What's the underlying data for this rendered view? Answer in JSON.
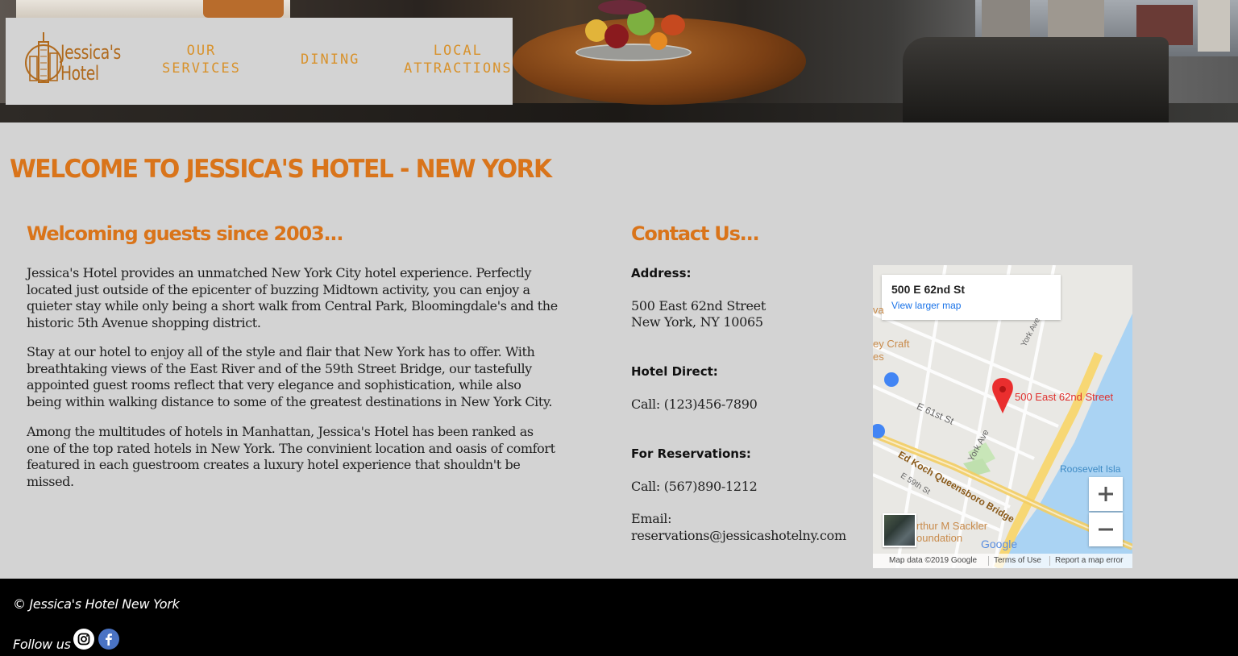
{
  "brand": {
    "logo_text_line1": "Jessica's",
    "logo_text_line2": "Hotel",
    "accent_color": "#d9741a",
    "nav_color": "#d8922c"
  },
  "nav": {
    "items": [
      {
        "line1": "OUR",
        "line2": "SERVICES"
      },
      {
        "line1": "DINING",
        "line2": ""
      },
      {
        "line1": "LOCAL",
        "line2": "ATTRACTIONS"
      }
    ]
  },
  "main": {
    "title": "WELCOME TO JESSICA'S HOTEL - NEW YORK",
    "about": {
      "heading": "Welcoming guests since 2003...",
      "paragraphs": [
        "Jessica's Hotel provides an unmatched New York City hotel experience. Perfectly located just outside of the epicenter of buzzing Midtown activity, you can enjoy a quieter stay while only being a short walk from Central Park, Bloomingdale's and the historic 5th Avenue shopping district.",
        "Stay at our hotel to enjoy all of the style and flair that New York has to offer. With breathtaking views of the East River and of the 59th Street Bridge, our tastefully appointed guest rooms reflect that very elegance and sophistication, while also being within walking distance to some of the greatest destinations in New York City.",
        "Among the multitudes of hotels in Manhattan, Jessica's Hotel has been ranked as one of the top rated hotels in New York. The convinient location and oasis of comfort featured in each guestroom creates a luxury hotel experience that shouldn't be missed."
      ]
    },
    "contact": {
      "heading": "Contact Us...",
      "address_label": "Address:",
      "address_line1": "500 East 62nd Street",
      "address_line2": "New York, NY 10065",
      "direct_label": "Hotel Direct:",
      "direct_phone": "Call: (123)456-7890",
      "reservations_label": "For Reservations:",
      "reservations_phone": "Call: (567)890-1212",
      "email_label": "Email:",
      "email": "reservations@jessicashotelny.com"
    }
  },
  "map": {
    "card_title": "500 E 62nd St",
    "view_larger": "View larger map",
    "pin_label": "500 East 62nd Street",
    "labels": {
      "craft_1": "ey Craft",
      "craft_2": "es",
      "va": "va",
      "e61": "E 61st St",
      "york_ave_1": "York Ave",
      "york_ave_2": "York Ave",
      "bridge": "Ed Koch Queensboro Bridge",
      "e59": "E 59th St",
      "roosevelt": "Roosevelt Isla",
      "sackler_1": "rthur M Sackler",
      "sackler_2": "oundation",
      "google": "Google"
    },
    "zoom_in_icon": "plus-icon",
    "zoom_out_icon": "minus-icon",
    "footer": {
      "data": "Map data ©2019 Google",
      "terms": "Terms of Use",
      "report": "Report a map error"
    },
    "colors": {
      "water": "#aad3f3",
      "road_major": "#f7d774",
      "park": "#c8e6b8"
    }
  },
  "footer": {
    "copyright": "© Jessica's Hotel New York",
    "follow": "Follow us",
    "social_icons": [
      "instagram-icon",
      "facebook-icon"
    ]
  }
}
